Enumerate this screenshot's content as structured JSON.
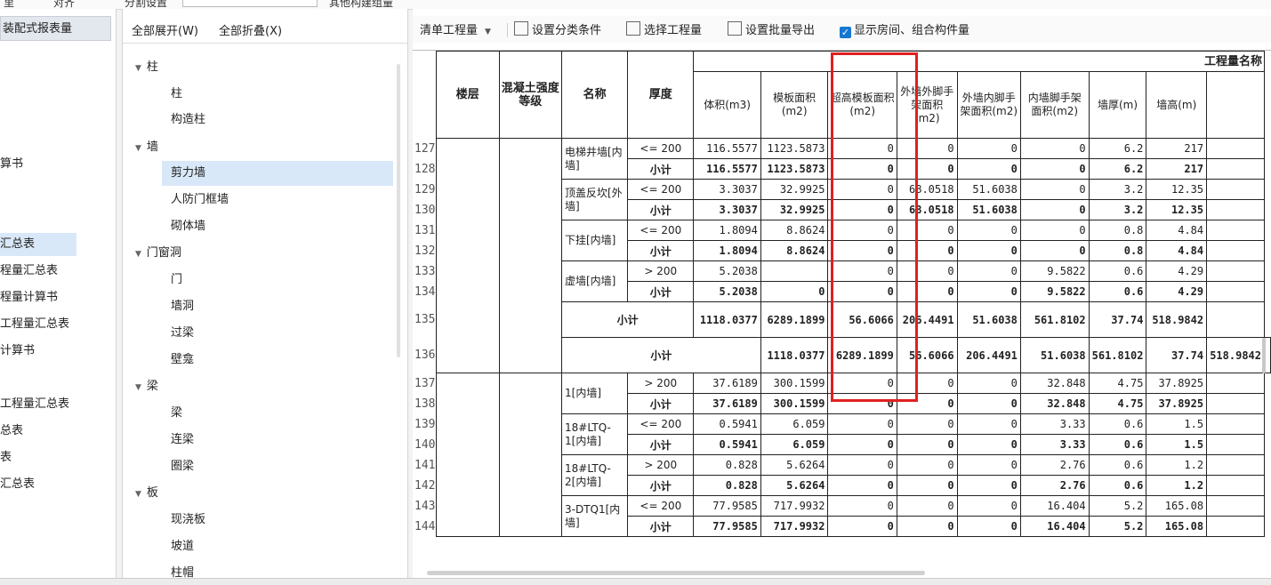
{
  "topbar": {
    "fragment_1": "里",
    "fragment_2": "对齐",
    "fragment_3": "分割设置",
    "fragment_4": "其他构建组量"
  },
  "leftnav": {
    "header": "装配式报表量",
    "items": [
      {
        "label": "算书",
        "selected": false
      },
      {
        "label": "汇总表",
        "selected": true
      },
      {
        "label": "程量汇总表",
        "selected": false
      },
      {
        "label": "程量计算书",
        "selected": false
      },
      {
        "label": "工程量汇总表",
        "selected": false
      },
      {
        "label": "计算书",
        "selected": false
      },
      {
        "label": "工程量汇总表",
        "selected": false
      },
      {
        "label": "总表",
        "selected": false
      },
      {
        "label": "表",
        "selected": false
      },
      {
        "label": "汇总表",
        "selected": false
      }
    ]
  },
  "tree": {
    "expand_all": "全部展开(W)",
    "collapse_all": "全部折叠(X)",
    "nodes": [
      {
        "type": "cat",
        "label": "柱"
      },
      {
        "type": "leaf",
        "label": "柱"
      },
      {
        "type": "leaf",
        "label": "构造柱"
      },
      {
        "type": "cat",
        "label": "墙"
      },
      {
        "type": "leaf",
        "label": "剪力墙",
        "selected": true
      },
      {
        "type": "leaf",
        "label": "人防门框墙"
      },
      {
        "type": "leaf",
        "label": "砌体墙"
      },
      {
        "type": "cat",
        "label": "门窗洞"
      },
      {
        "type": "leaf",
        "label": "门"
      },
      {
        "type": "leaf",
        "label": "墙洞"
      },
      {
        "type": "leaf",
        "label": "过梁"
      },
      {
        "type": "leaf",
        "label": "壁龛"
      },
      {
        "type": "cat",
        "label": "梁"
      },
      {
        "type": "leaf",
        "label": "梁"
      },
      {
        "type": "leaf",
        "label": "连梁"
      },
      {
        "type": "leaf",
        "label": "圈梁"
      },
      {
        "type": "cat",
        "label": "板"
      },
      {
        "type": "leaf",
        "label": "现浇板"
      },
      {
        "type": "leaf",
        "label": "坡道"
      },
      {
        "type": "leaf",
        "label": "柱帽"
      }
    ]
  },
  "toolbar": {
    "mode_select": "清单工程量",
    "set_category": "设置分类条件",
    "select_quantity": "选择工程量",
    "batch_export": "设置批量导出",
    "show_rooms_checked": true,
    "show_rooms": "显示房间、组合构件量"
  },
  "table": {
    "group_title": "工程量名称",
    "headers": {
      "floor": "楼层",
      "concrete": "混凝土强度等级",
      "name": "名称",
      "thickness": "厚度",
      "volume": "体积(m3)",
      "formwork": "模板面积(m2)",
      "high_formwork": "超高模板面积(m2)",
      "ext_scaffold_out": "外墙外脚手架面积(m2)",
      "ext_scaffold_in": "外墙内脚手架面积(m2)",
      "int_scaffold": "内墙脚手架面积(m2)",
      "wall_thick": "墙厚(m)",
      "wall_height": "墙高(m)"
    },
    "row_numbers": [
      "127",
      "128",
      "129",
      "130",
      "131",
      "132",
      "133",
      "134",
      "135",
      "136",
      "137",
      "138",
      "139",
      "140",
      "141",
      "142",
      "143",
      "144"
    ],
    "groups_a": [
      {
        "name": "电梯井墙[内墙]",
        "rows": [
          {
            "thk": "<= 200",
            "v": [
              "116.5577",
              "1123.5873",
              "0",
              "0",
              "0",
              "0",
              "6.2",
              "217"
            ],
            "bold": false
          },
          {
            "thk": "小计",
            "v": [
              "116.5577",
              "1123.5873",
              "0",
              "0",
              "0",
              "0",
              "6.2",
              "217"
            ],
            "bold": true
          }
        ]
      },
      {
        "name": "顶盖反坎[外墙]",
        "rows": [
          {
            "thk": "<= 200",
            "v": [
              "3.3037",
              "32.9925",
              "0",
              "68.0518",
              "51.6038",
              "0",
              "3.2",
              "12.35"
            ],
            "bold": false
          },
          {
            "thk": "小计",
            "v": [
              "3.3037",
              "32.9925",
              "0",
              "68.0518",
              "51.6038",
              "0",
              "3.2",
              "12.35"
            ],
            "bold": true
          }
        ]
      },
      {
        "name": "下挂[内墙]",
        "rows": [
          {
            "thk": "<= 200",
            "v": [
              "1.8094",
              "8.8624",
              "0",
              "0",
              "0",
              "0",
              "0.8",
              "4.84"
            ],
            "bold": false
          },
          {
            "thk": "小计",
            "v": [
              "1.8094",
              "8.8624",
              "0",
              "0",
              "0",
              "0",
              "0.8",
              "4.84"
            ],
            "bold": true
          }
        ]
      },
      {
        "name": "虚墙[内墙]",
        "rows": [
          {
            "thk": "> 200",
            "v": [
              "5.2038",
              "",
              "0",
              "0",
              "0",
              "9.5822",
              "0.6",
              "4.29"
            ],
            "bold": false
          },
          {
            "thk": "小计",
            "v": [
              "5.2038",
              "0",
              "0",
              "0",
              "0",
              "9.5822",
              "0.6",
              "4.29"
            ],
            "bold": true
          }
        ]
      }
    ],
    "subtotal_a": {
      "label": "小计",
      "v": [
        "1118.0377",
        "6289.1899",
        "56.6066",
        "206.4491",
        "51.6038",
        "561.8102",
        "37.74",
        "518.9842"
      ]
    },
    "subtotal_b": {
      "label": "小计",
      "v": [
        "1118.0377",
        "6289.1899",
        "56.6066",
        "206.4491",
        "51.6038",
        "561.8102",
        "37.74",
        "518.9842"
      ]
    },
    "groups_b": [
      {
        "name": "1[内墙]",
        "rows": [
          {
            "thk": "> 200",
            "v": [
              "37.6189",
              "300.1599",
              "0",
              "0",
              "0",
              "32.848",
              "4.75",
              "37.8925"
            ],
            "bold": false
          },
          {
            "thk": "小计",
            "v": [
              "37.6189",
              "300.1599",
              "0",
              "0",
              "0",
              "32.848",
              "4.75",
              "37.8925"
            ],
            "bold": true
          }
        ]
      },
      {
        "name": "18#LTQ-1[内墙]",
        "rows": [
          {
            "thk": "<= 200",
            "v": [
              "0.5941",
              "6.059",
              "0",
              "0",
              "0",
              "3.33",
              "0.6",
              "1.5"
            ],
            "bold": false
          },
          {
            "thk": "小计",
            "v": [
              "0.5941",
              "6.059",
              "0",
              "0",
              "0",
              "3.33",
              "0.6",
              "1.5"
            ],
            "bold": true
          }
        ]
      },
      {
        "name": "18#LTQ-2[内墙]",
        "rows": [
          {
            "thk": "> 200",
            "v": [
              "0.828",
              "5.6264",
              "0",
              "0",
              "0",
              "2.76",
              "0.6",
              "1.2"
            ],
            "bold": false
          },
          {
            "thk": "小计",
            "v": [
              "0.828",
              "5.6264",
              "0",
              "0",
              "0",
              "2.76",
              "0.6",
              "1.2"
            ],
            "bold": true
          }
        ]
      },
      {
        "name": "3-DTQ1[内墙]",
        "rows": [
          {
            "thk": "<= 200",
            "v": [
              "77.9585",
              "717.9932",
              "0",
              "0",
              "0",
              "16.404",
              "5.2",
              "165.08"
            ],
            "bold": false
          },
          {
            "thk": "小计",
            "v": [
              "77.9585",
              "717.9932",
              "0",
              "0",
              "0",
              "16.404",
              "5.2",
              "165.08"
            ],
            "bold": true
          }
        ]
      }
    ]
  }
}
